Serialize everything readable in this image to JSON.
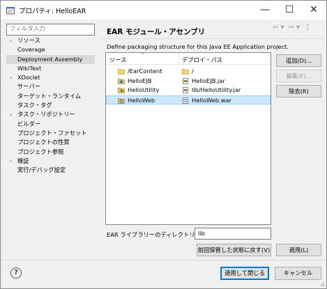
{
  "window": {
    "title": "プロパティ: HelloEAR",
    "minimize_glyph": "—",
    "maximize_glyph": "☐",
    "close_glyph": "✕"
  },
  "sidebar": {
    "filter_placeholder": "フィルタ入力",
    "items": [
      {
        "label": "リソース",
        "expandable": true
      },
      {
        "label": "Coverage",
        "expandable": false
      },
      {
        "label": "Deployment Assembly",
        "expandable": false,
        "selected": true
      },
      {
        "label": "WikiText",
        "expandable": false
      },
      {
        "label": "XDoclet",
        "expandable": true
      },
      {
        "label": "サーバー",
        "expandable": false
      },
      {
        "label": "ターゲット・ランタイム",
        "expandable": false
      },
      {
        "label": "タスク・タグ",
        "expandable": false
      },
      {
        "label": "タスク・リポジトリー",
        "expandable": true
      },
      {
        "label": "ビルダー",
        "expandable": false
      },
      {
        "label": "プロジェクト・ファセット",
        "expandable": false
      },
      {
        "label": "プロジェクトの性質",
        "expandable": false
      },
      {
        "label": "プロジェクト参照",
        "expandable": false
      },
      {
        "label": "検証",
        "expandable": true
      },
      {
        "label": "実行/デバッグ設定",
        "expandable": false
      }
    ]
  },
  "header": {
    "title": "EAR モジュール・アセンブリ",
    "nav_back": "⇦",
    "nav_back_menu": "▾",
    "nav_forward": "⇨",
    "nav_forward_menu": "▾",
    "view_menu": "⋮"
  },
  "main": {
    "description": "Define packaging structure for this Java EE Application project.",
    "table": {
      "col_source": "ソース",
      "col_deploy_path": "デプロイ・パス",
      "rows": [
        {
          "source": "/EarContent",
          "source_icon": "folder-icon",
          "deploy_path": "/",
          "deploy_icon": "folder-icon",
          "selected": false
        },
        {
          "source": "HelloEJB",
          "source_icon": "ejb-project-icon",
          "deploy_path": "HelloEJB.jar",
          "deploy_icon": "jar-file-icon",
          "selected": false
        },
        {
          "source": "HelloUtility",
          "source_icon": "java-project-icon",
          "deploy_path": "lib/HelloUtility.jar",
          "deploy_icon": "jar-file-icon",
          "selected": false
        },
        {
          "source": "HelloWeb",
          "source_icon": "web-project-icon",
          "deploy_path": "HelloWeb.war",
          "deploy_icon": "war-file-icon",
          "selected": true
        }
      ]
    },
    "buttons": {
      "add": "追加(D)...",
      "edit": "編集(E)...",
      "remove": "除去(R)"
    },
    "ear_library": {
      "label": "EAR ライブラリーのディレクトリー(L):",
      "value": "lib"
    },
    "restore_defaults": "前回保管した状態に戻す(V)",
    "apply": "適用(L)"
  },
  "footer": {
    "help_glyph": "?",
    "apply_and_close": "適用して閉じる",
    "cancel": "キャンセル"
  },
  "colors": {
    "selection_bg": "#cce8ff",
    "selection_border": "#99d1ff",
    "primary_border": "#0078d7",
    "folder": "#e8c25a",
    "jar": "#8a6a3a"
  }
}
